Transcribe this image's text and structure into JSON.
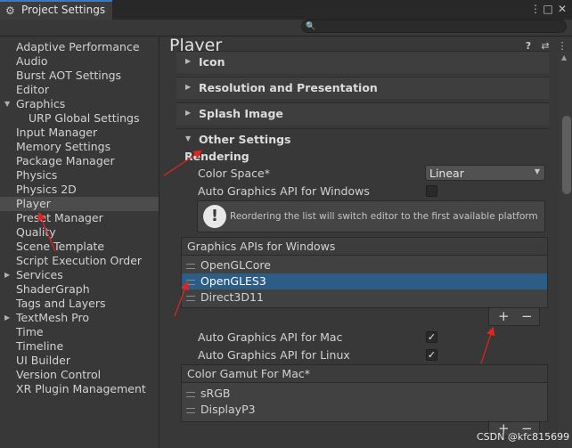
{
  "window": {
    "tab_label": "Project Settings",
    "tab_icon": "gear-icon"
  },
  "search": {
    "placeholder": ""
  },
  "sidebar": {
    "items": [
      {
        "label": "Adaptive Performance"
      },
      {
        "label": "Audio"
      },
      {
        "label": "Burst AOT Settings"
      },
      {
        "label": "Editor"
      },
      {
        "label": "Graphics",
        "expanded": true
      },
      {
        "label": "URP Global Settings",
        "sub": true
      },
      {
        "label": "Input Manager"
      },
      {
        "label": "Memory Settings"
      },
      {
        "label": "Package Manager"
      },
      {
        "label": "Physics"
      },
      {
        "label": "Physics 2D"
      },
      {
        "label": "Player",
        "selected": true
      },
      {
        "label": "Preset Manager"
      },
      {
        "label": "Quality"
      },
      {
        "label": "Scene Template"
      },
      {
        "label": "Script Execution Order"
      },
      {
        "label": "Services",
        "collapsed": true
      },
      {
        "label": "ShaderGraph"
      },
      {
        "label": "Tags and Layers"
      },
      {
        "label": "TextMesh Pro",
        "collapsed": true
      },
      {
        "label": "Time"
      },
      {
        "label": "Timeline"
      },
      {
        "label": "UI Builder"
      },
      {
        "label": "Version Control"
      },
      {
        "label": "XR Plugin Management"
      }
    ]
  },
  "main": {
    "title": "Player",
    "sections": {
      "icon": "Icon",
      "resolution": "Resolution and Presentation",
      "splash": "Splash Image",
      "other": "Other Settings"
    },
    "rendering_label": "Rendering",
    "color_space_label": "Color Space*",
    "color_space_value": "Linear",
    "auto_graphics_windows_label": "Auto Graphics API  for Windows",
    "auto_graphics_windows_checked": false,
    "help_message": "Reordering the list will switch editor to the first available platform",
    "graphics_apis_header": "Graphics APIs for Windows",
    "graphics_apis": [
      "OpenGLCore",
      "OpenGLES3",
      "Direct3D11"
    ],
    "graphics_apis_selected": "OpenGLES3",
    "auto_graphics_mac_label": "Auto Graphics API  for Mac",
    "auto_graphics_mac_checked": true,
    "auto_graphics_linux_label": "Auto Graphics API  for Linux",
    "auto_graphics_linux_checked": true,
    "color_gamut_header": "Color Gamut For Mac*",
    "color_gamut": [
      "sRGB",
      "DisplayP3"
    ],
    "plus_label": "+",
    "minus_label": "−"
  },
  "watermark": "CSDN @kfc815699",
  "colors": {
    "selection": "#2c5d87",
    "annotation_arrow": "#e0261f",
    "accent_tab": "#3a79bb"
  }
}
